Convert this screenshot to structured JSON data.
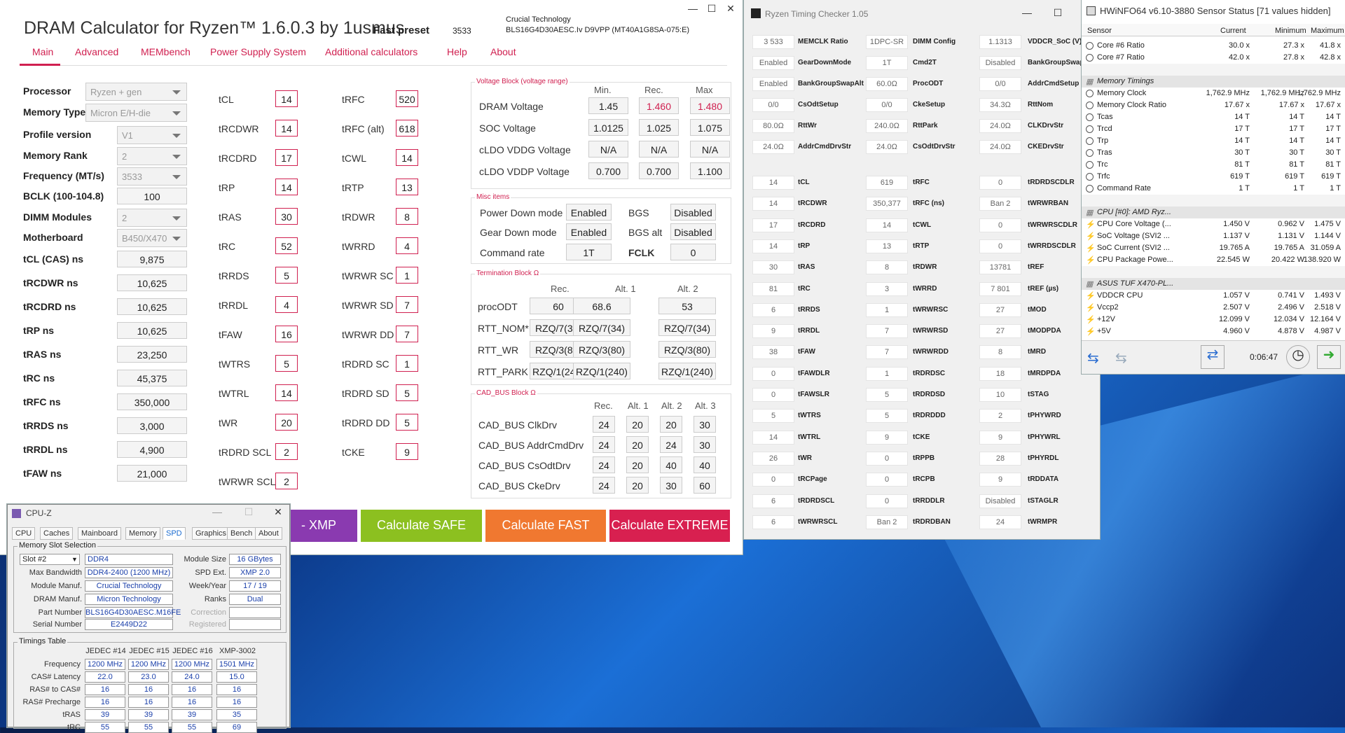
{
  "dram": {
    "title": "DRAM Calculator for Ryzen™ 1.6.0.3 by 1usmus",
    "preset_label": "Fast preset",
    "preset_value": "3533",
    "module_vendor": "Crucial Technology",
    "module_part": "BLS16G4D30AESC.Iv D9VPP (MT40A1G8SA-075:E)",
    "tabs": [
      "Main",
      "Advanced",
      "MEMbench",
      "Power Supply System",
      "Additional calculators",
      "Help",
      "About"
    ],
    "left_dropdowns": [
      {
        "label": "Processor",
        "value": "Ryzen + gen"
      },
      {
        "label": "Memory Type",
        "value": "Micron E/H-die"
      },
      {
        "label": "Profile version",
        "value": "V1"
      },
      {
        "label": "Memory Rank",
        "value": "2"
      },
      {
        "label": "Frequency (MT/s)",
        "value": "3533"
      },
      {
        "label": "BCLK (100-104.8)",
        "value": "100"
      },
      {
        "label": "DIMM Modules",
        "value": "2"
      },
      {
        "label": "Motherboard",
        "value": "B450/X470"
      }
    ],
    "ns_rows": [
      {
        "label": "tCL (CAS) ns",
        "value": "9,875"
      },
      {
        "label": "tRCDWR ns",
        "value": "10,625"
      },
      {
        "label": "tRCDRD ns",
        "value": "10,625"
      },
      {
        "label": "tRP ns",
        "value": "10,625"
      },
      {
        "label": "tRAS ns",
        "value": "23,250"
      },
      {
        "label": "tRC ns",
        "value": "45,375"
      },
      {
        "label": "tRFC ns",
        "value": "350,000"
      },
      {
        "label": "tRRDS ns",
        "value": "3,000"
      },
      {
        "label": "tRRDL ns",
        "value": "4,900"
      },
      {
        "label": "tFAW ns",
        "value": "21,000"
      }
    ],
    "timings_a": [
      {
        "label": "tCL",
        "value": "14"
      },
      {
        "label": "tRCDWR",
        "value": "14"
      },
      {
        "label": "tRCDRD",
        "value": "17"
      },
      {
        "label": "tRP",
        "value": "14"
      },
      {
        "label": "tRAS",
        "value": "30"
      },
      {
        "label": "tRC",
        "value": "52"
      },
      {
        "label": "tRRDS",
        "value": "5"
      },
      {
        "label": "tRRDL",
        "value": "4"
      },
      {
        "label": "tFAW",
        "value": "16"
      },
      {
        "label": "tWTRS",
        "value": "5"
      },
      {
        "label": "tWTRL",
        "value": "14"
      },
      {
        "label": "tWR",
        "value": "20"
      },
      {
        "label": "tRDRD SCL",
        "value": "2"
      },
      {
        "label": "tWRWR SCL",
        "value": "2"
      }
    ],
    "timings_b": [
      {
        "label": "tRFC",
        "value": "520"
      },
      {
        "label": "tRFC (alt)",
        "value": "618"
      },
      {
        "label": "tCWL",
        "value": "14"
      },
      {
        "label": "tRTP",
        "value": "13"
      },
      {
        "label": "tRDWR",
        "value": "8"
      },
      {
        "label": "tWRRD",
        "value": "4"
      },
      {
        "label": "tWRWR SC",
        "value": "1"
      },
      {
        "label": "tWRWR SD",
        "value": "7"
      },
      {
        "label": "tWRWR DD",
        "value": "7"
      },
      {
        "label": "tRDRD SC",
        "value": "1"
      },
      {
        "label": "tRDRD SD",
        "value": "5"
      },
      {
        "label": "tRDRD DD",
        "value": "5"
      },
      {
        "label": "tCKE",
        "value": "9"
      }
    ],
    "voltage": {
      "title": "Voltage Block (voltage range)",
      "headers": [
        "Min.",
        "Rec.",
        "Max"
      ],
      "rows": [
        {
          "label": "DRAM Voltage",
          "min": "1.45",
          "rec": "1.460",
          "max": "1.480"
        },
        {
          "label": "SOC Voltage",
          "min": "1.0125",
          "rec": "1.025",
          "max": "1.075"
        },
        {
          "label": "cLDO VDDG Voltage",
          "min": "N/A",
          "rec": "N/A",
          "max": "N/A"
        },
        {
          "label": "cLDO VDDP Voltage",
          "min": "0.700",
          "rec": "0.700",
          "max": "1.100"
        }
      ]
    },
    "misc": {
      "title": "Misc items",
      "power_down_label": "Power Down mode",
      "power_down": "Enabled",
      "bgs_label": "BGS",
      "bgs": "Disabled",
      "gear_down_label": "Gear Down mode",
      "gear_down": "Enabled",
      "bgs_alt_label": "BGS alt",
      "bgs_alt": "Disabled",
      "cmd_rate_label": "Command rate",
      "cmd_rate": "1T",
      "fclk_label": "FCLK",
      "fclk": "0"
    },
    "term": {
      "title": "Termination Block Ω",
      "headers": [
        "Rec.",
        "Alt. 1",
        "Alt. 2"
      ],
      "rows": [
        {
          "label": "procODT",
          "v": [
            "60",
            "68.6",
            "53"
          ]
        },
        {
          "label": "RTT_NOM*",
          "v": [
            "RZQ/7(34)",
            "RZQ/7(34)",
            "RZQ/7(34)"
          ]
        },
        {
          "label": "RTT_WR",
          "v": [
            "RZQ/3(80)",
            "RZQ/3(80)",
            "RZQ/3(80)"
          ]
        },
        {
          "label": "RTT_PARK",
          "v": [
            "RZQ/1(240)",
            "RZQ/1(240)",
            "RZQ/1(240)"
          ]
        }
      ]
    },
    "cad": {
      "title": "CAD_BUS Block Ω",
      "headers": [
        "Rec.",
        "Alt. 1",
        "Alt. 2",
        "Alt. 3"
      ],
      "rows": [
        {
          "label": "CAD_BUS ClkDrv",
          "v": [
            "24",
            "20",
            "20",
            "30"
          ]
        },
        {
          "label": "CAD_BUS AddrCmdDrv",
          "v": [
            "24",
            "20",
            "24",
            "30"
          ]
        },
        {
          "label": "CAD_BUS CsOdtDrv",
          "v": [
            "24",
            "20",
            "40",
            "40"
          ]
        },
        {
          "label": "CAD_BUS CkeDrv",
          "v": [
            "24",
            "20",
            "30",
            "60"
          ]
        }
      ]
    },
    "buttons": {
      "xmp": "- XMP",
      "safe": "Calculate SAFE",
      "fast": "Calculate FAST",
      "extreme": "Calculate EXTREME"
    },
    "colors": {
      "accent": "#d02050",
      "xmp": "#8a3ab0",
      "safe": "#8cc020",
      "fast": "#f07830",
      "extreme": "#d82050"
    }
  },
  "rtc": {
    "title": "Ryzen Timing Checker 1.05",
    "top": [
      [
        "3 533",
        "MEMCLK Ratio",
        "1DPC-SR",
        "DIMM Config",
        "1.1313",
        "VDDCR_SoC (V)"
      ],
      [
        "Enabled",
        "GearDownMode",
        "1T",
        "Cmd2T",
        "Disabled",
        "BankGroupSwap"
      ],
      [
        "Enabled",
        "BankGroupSwapAlt",
        "60.0Ω",
        "ProcODT",
        "0/0",
        "AddrCmdSetup"
      ],
      [
        "0/0",
        "CsOdtSetup",
        "0/0",
        "CkeSetup",
        "34.3Ω",
        "RttNom"
      ],
      [
        "80.0Ω",
        "RttWr",
        "240.0Ω",
        "RttPark",
        "24.0Ω",
        "CLKDrvStr"
      ],
      [
        "24.0Ω",
        "AddrCmdDrvStr",
        "24.0Ω",
        "CsOdtDrvStr",
        "24.0Ω",
        "CKEDrvStr"
      ]
    ],
    "rows": [
      [
        "14",
        "tCL",
        "619",
        "tRFC",
        "0",
        "tRDRDSCDLR"
      ],
      [
        "14",
        "tRCDWR",
        "350,377",
        "tRFC (ns)",
        "Ban 2",
        "tWRWRBAN"
      ],
      [
        "17",
        "tRCDRD",
        "14",
        "tCWL",
        "0",
        "tWRWRSCDLR"
      ],
      [
        "14",
        "tRP",
        "13",
        "tRTP",
        "0",
        "tWRRDSCDLR"
      ],
      [
        "30",
        "tRAS",
        "8",
        "tRDWR",
        "13781",
        "tREF"
      ],
      [
        "81",
        "tRC",
        "3",
        "tWRRD",
        "7 801",
        "tREF (µs)"
      ],
      [
        "6",
        "tRRDS",
        "1",
        "tWRWRSC",
        "27",
        "tMOD"
      ],
      [
        "9",
        "tRRDL",
        "7",
        "tWRWRSD",
        "27",
        "tMODPDA"
      ],
      [
        "38",
        "tFAW",
        "7",
        "tWRWRDD",
        "8",
        "tMRD"
      ],
      [
        "0",
        "tFAWDLR",
        "1",
        "tRDRDSC",
        "18",
        "tMRDPDA"
      ],
      [
        "0",
        "tFAWSLR",
        "5",
        "tRDRDSD",
        "10",
        "tSTAG"
      ],
      [
        "5",
        "tWTRS",
        "5",
        "tRDRDDD",
        "2",
        "tPHYWRD"
      ],
      [
        "14",
        "tWTRL",
        "9",
        "tCKE",
        "9",
        "tPHYWRL"
      ],
      [
        "26",
        "tWR",
        "0",
        "tRPPB",
        "28",
        "tPHYRDL"
      ],
      [
        "0",
        "tRCPage",
        "0",
        "tRCPB",
        "9",
        "tRDDATA"
      ],
      [
        "6",
        "tRDRDSCL",
        "0",
        "tRRDDLR",
        "Disabled",
        "tSTAGLR"
      ],
      [
        "6",
        "tWRWRSCL",
        "Ban 2",
        "tRDRDBAN",
        "24",
        "tWRMPR"
      ]
    ]
  },
  "hw": {
    "title": "HWiNFO64 v6.10-3880 Sensor Status [71 values hidden]",
    "headers": [
      "Sensor",
      "Current",
      "Minimum",
      "Maximum"
    ],
    "rows": [
      {
        "t": "r",
        "n": "Core #6 Ratio",
        "c": "30.0 x",
        "mi": "27.3 x",
        "ma": "41.8 x"
      },
      {
        "t": "r",
        "n": "Core #7 Ratio",
        "c": "42.0 x",
        "mi": "27.8 x",
        "ma": "42.8 x"
      },
      {
        "t": "g",
        "n": "",
        "c": "",
        "mi": "",
        "ma": ""
      },
      {
        "t": "s",
        "n": "Memory Timings",
        "c": "",
        "mi": "",
        "ma": ""
      },
      {
        "t": "r",
        "n": "Memory Clock",
        "c": "1,762.9 MHz",
        "mi": "1,762.9 MHz",
        "ma": "1,762.9 MHz"
      },
      {
        "t": "r",
        "n": "Memory Clock Ratio",
        "c": "17.67 x",
        "mi": "17.67 x",
        "ma": "17.67 x"
      },
      {
        "t": "r",
        "n": "Tcas",
        "c": "14 T",
        "mi": "14 T",
        "ma": "14 T"
      },
      {
        "t": "r",
        "n": "Trcd",
        "c": "17 T",
        "mi": "17 T",
        "ma": "17 T"
      },
      {
        "t": "r",
        "n": "Trp",
        "c": "14 T",
        "mi": "14 T",
        "ma": "14 T"
      },
      {
        "t": "r",
        "n": "Tras",
        "c": "30 T",
        "mi": "30 T",
        "ma": "30 T"
      },
      {
        "t": "r",
        "n": "Trc",
        "c": "81 T",
        "mi": "81 T",
        "ma": "81 T"
      },
      {
        "t": "r",
        "n": "Trfc",
        "c": "619 T",
        "mi": "619 T",
        "ma": "619 T"
      },
      {
        "t": "r",
        "n": "Command Rate",
        "c": "1 T",
        "mi": "1 T",
        "ma": "1 T"
      },
      {
        "t": "g",
        "n": "",
        "c": "",
        "mi": "",
        "ma": ""
      },
      {
        "t": "s",
        "n": "CPU [#0]: AMD Ryz...",
        "c": "",
        "mi": "",
        "ma": ""
      },
      {
        "t": "b",
        "n": "CPU Core Voltage (...",
        "c": "1.450 V",
        "mi": "0.962 V",
        "ma": "1.475 V"
      },
      {
        "t": "b",
        "n": "SoC Voltage (SVI2 ...",
        "c": "1.137 V",
        "mi": "1.131 V",
        "ma": "1.144 V"
      },
      {
        "t": "b",
        "n": "SoC Current (SVI2 ...",
        "c": "19.765 A",
        "mi": "19.765 A",
        "ma": "31.059 A"
      },
      {
        "t": "b",
        "n": "CPU Package Powe...",
        "c": "22.545 W",
        "mi": "20.422 W",
        "ma": "138.920 W"
      },
      {
        "t": "g",
        "n": "",
        "c": "",
        "mi": "",
        "ma": ""
      },
      {
        "t": "s",
        "n": "ASUS TUF X470-PL...",
        "c": "",
        "mi": "",
        "ma": ""
      },
      {
        "t": "b",
        "n": "VDDCR CPU",
        "c": "1.057 V",
        "mi": "0.741 V",
        "ma": "1.493 V"
      },
      {
        "t": "b",
        "n": "Vccp2",
        "c": "2.507 V",
        "mi": "2.496 V",
        "ma": "2.518 V"
      },
      {
        "t": "b",
        "n": "+12V",
        "c": "12.099 V",
        "mi": "12.034 V",
        "ma": "12.164 V"
      },
      {
        "t": "b",
        "n": "+5V",
        "c": "4.960 V",
        "mi": "4.878 V",
        "ma": "4.987 V"
      }
    ],
    "timer": "0:06:47"
  },
  "cpuz": {
    "title": "CPU-Z",
    "tabs": [
      "CPU",
      "Caches",
      "Mainboard",
      "Memory",
      "SPD",
      "Graphics",
      "Bench",
      "About"
    ],
    "active_tab": "SPD",
    "slot_group": "Memory Slot Selection",
    "slot": "Slot #2",
    "type": "DDR4",
    "module_size_label": "Module Size",
    "module_size": "16 GBytes",
    "max_bw_label": "Max Bandwidth",
    "max_bw": "DDR4-2400 (1200 MHz)",
    "spd_ext_label": "SPD Ext.",
    "spd_ext": "XMP 2.0",
    "module_manuf_label": "Module Manuf.",
    "module_manuf": "Crucial Technology",
    "week_label": "Week/Year",
    "week": "17 / 19",
    "dram_manuf_label": "DRAM Manuf.",
    "dram_manuf": "Micron Technology",
    "ranks_label": "Ranks",
    "ranks": "Dual",
    "part_label": "Part Number",
    "part": "BLS16G4D30AESC.M16FE",
    "correction_label": "Correction",
    "serial_label": "Serial Number",
    "serial": "E2449D22",
    "registered_label": "Registered",
    "timings_group": "Timings Table",
    "t_headers": [
      "JEDEC #14",
      "JEDEC #15",
      "JEDEC #16",
      "XMP-3002"
    ],
    "t_rows": [
      {
        "label": "Frequency",
        "v": [
          "1200 MHz",
          "1200 MHz",
          "1200 MHz",
          "1501 MHz"
        ]
      },
      {
        "label": "CAS# Latency",
        "v": [
          "22.0",
          "23.0",
          "24.0",
          "15.0"
        ]
      },
      {
        "label": "RAS# to CAS#",
        "v": [
          "16",
          "16",
          "16",
          "16"
        ]
      },
      {
        "label": "RAS# Precharge",
        "v": [
          "16",
          "16",
          "16",
          "16"
        ]
      },
      {
        "label": "tRAS",
        "v": [
          "39",
          "39",
          "39",
          "35"
        ]
      },
      {
        "label": "tRC",
        "v": [
          "55",
          "55",
          "55",
          "69"
        ]
      }
    ]
  }
}
